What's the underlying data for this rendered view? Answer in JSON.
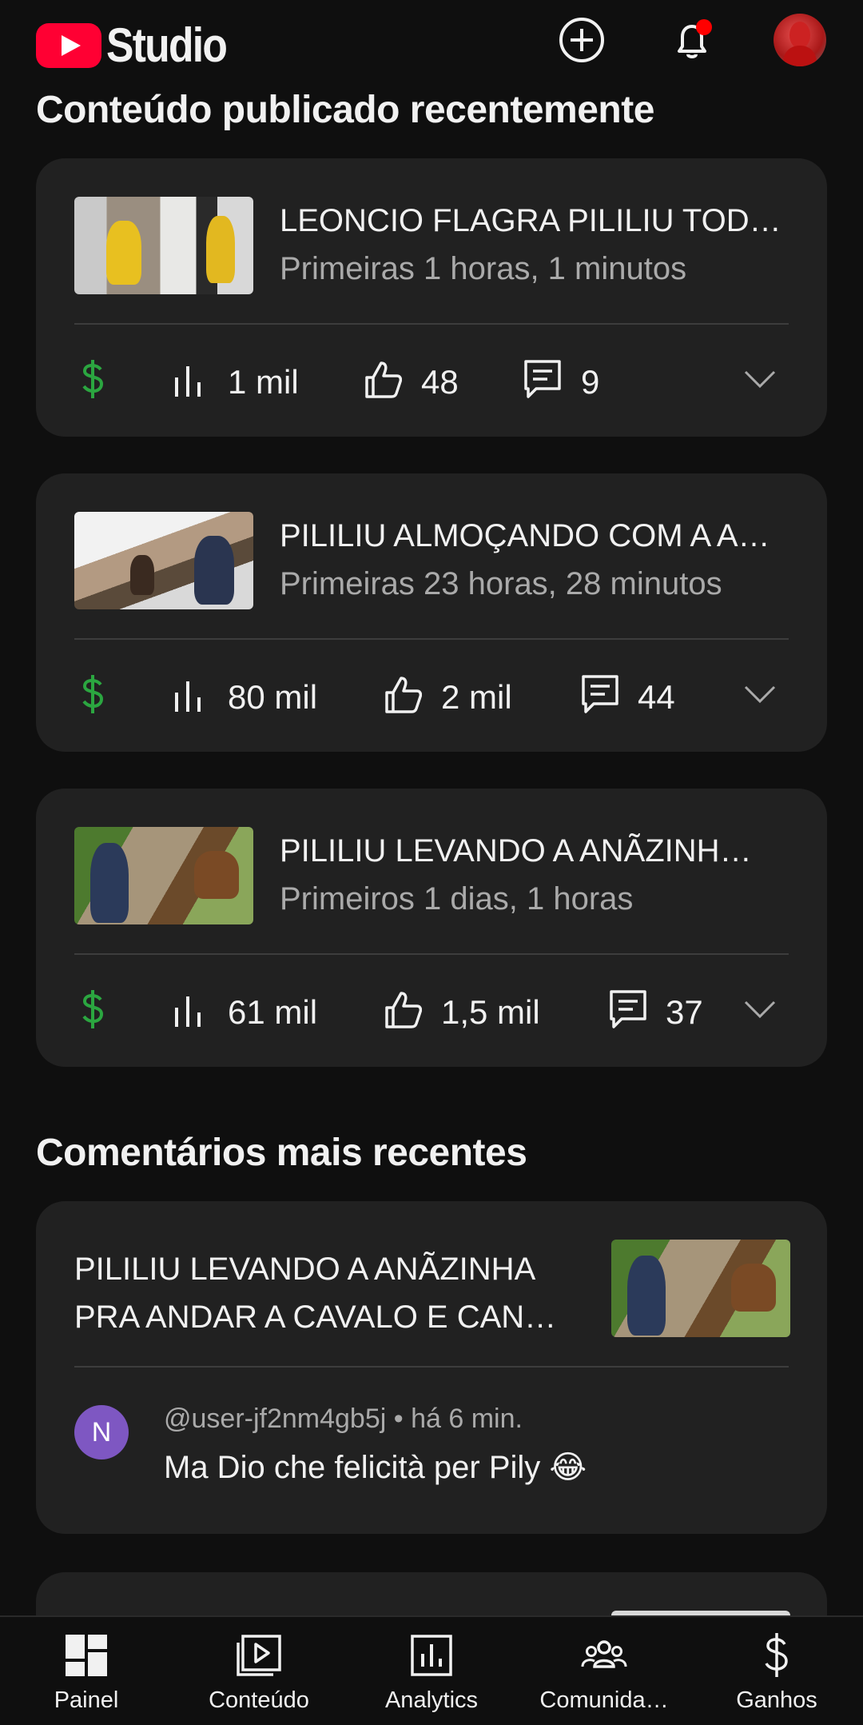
{
  "app": {
    "brand": "Studio",
    "accent": "#ff0033"
  },
  "header": {
    "icons": [
      "create-icon",
      "notifications-icon",
      "account-avatar"
    ],
    "notification_dot_color": "#ff0000"
  },
  "recent_content": {
    "title": "Conteúdo publicado recentemente",
    "videos": [
      {
        "title": "LEONCIO FLAGRA PILILIU TOD…",
        "sub": "Primeiras 1 horas, 1 minutos",
        "views": "1 mil",
        "likes": "48",
        "comments": "9"
      },
      {
        "title": "PILILIU ALMOÇANDO COM A A…",
        "sub": "Primeiras 23 horas, 28 minutos",
        "views": "80 mil",
        "likes": "2 mil",
        "comments": "44"
      },
      {
        "title": "PILILIU LEVANDO A ANÃZINH…",
        "sub": "Primeiros 1 dias, 1 horas",
        "views": "61 mil",
        "likes": "1,5 mil",
        "comments": "37"
      }
    ],
    "monetization_color": "#2ba640"
  },
  "recent_comments": {
    "title": "Comentários mais recentes",
    "items": [
      {
        "video_title": "PILILIU LEVANDO A ANÃZINHA PRA ANDAR A CAVALO E CAN…",
        "avatar_letter": "N",
        "author_meta": "@user-jf2nm4gb5j • há 6 min.",
        "text": "Ma Dio che felicità  per Pily 😂"
      }
    ]
  },
  "bottom_nav": {
    "items": [
      {
        "label": "Painel",
        "icon": "dashboard-icon"
      },
      {
        "label": "Conteúdo",
        "icon": "content-icon"
      },
      {
        "label": "Analytics",
        "icon": "analytics-icon"
      },
      {
        "label": "Comunida…",
        "icon": "community-icon"
      },
      {
        "label": "Ganhos",
        "icon": "earn-icon"
      }
    ]
  }
}
